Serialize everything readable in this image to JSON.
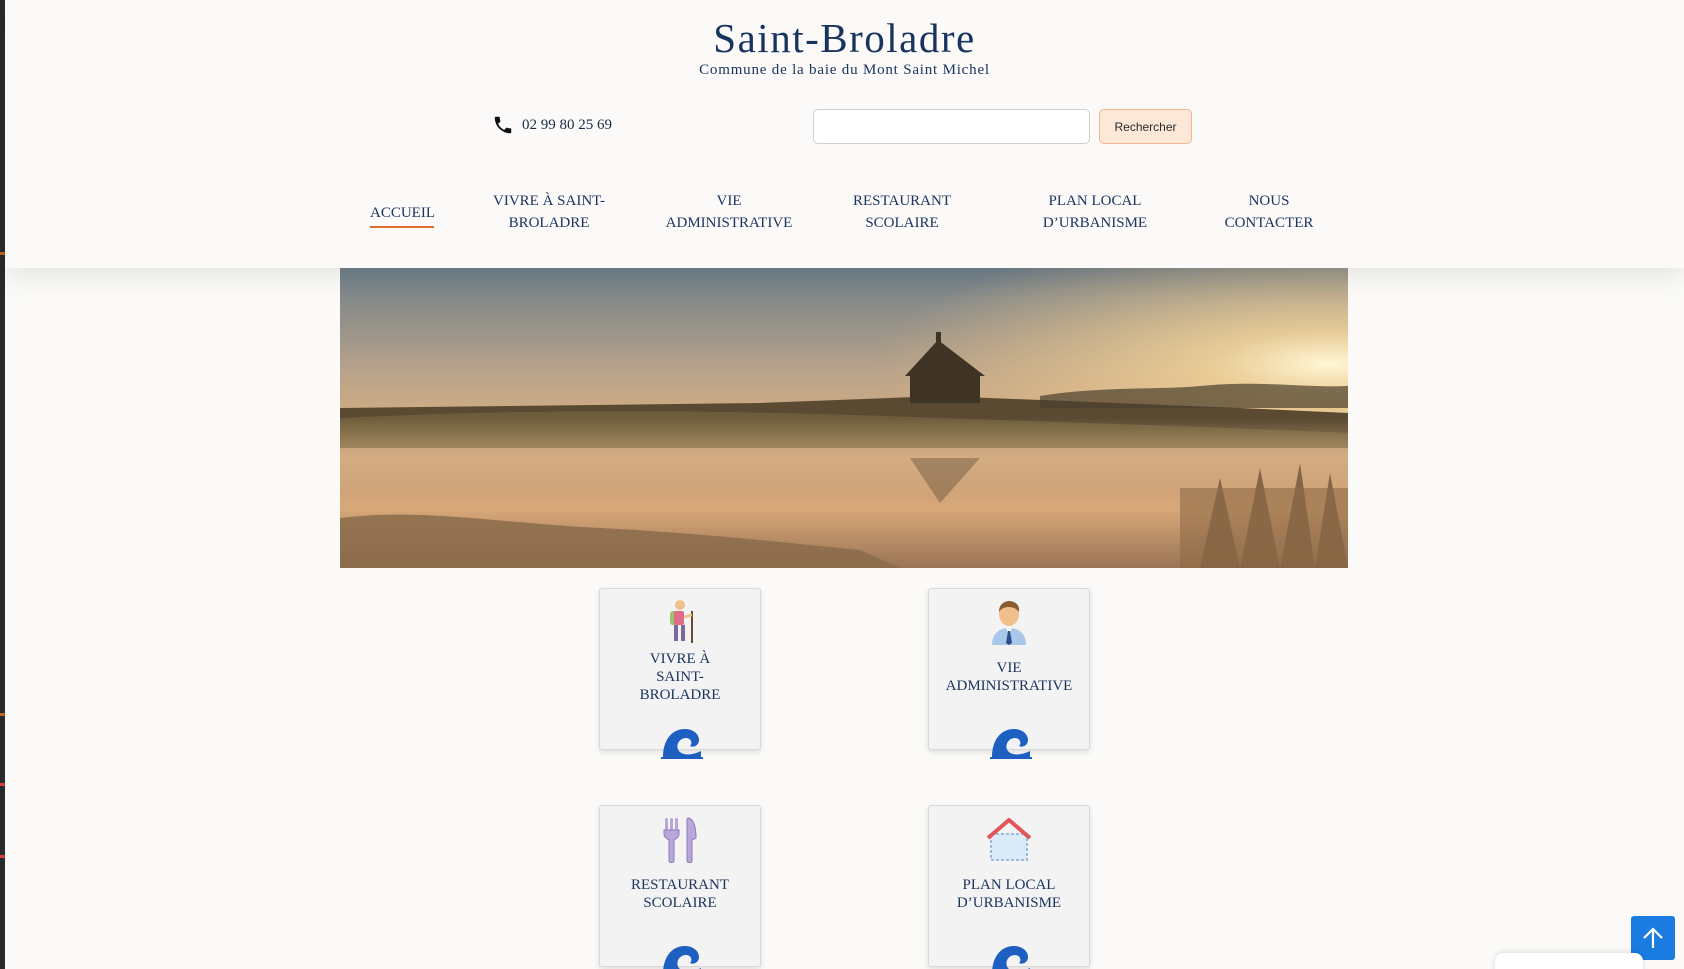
{
  "site": {
    "title": "Saint-Broladre",
    "tagline": "Commune de la baie du Mont Saint Michel"
  },
  "contact": {
    "phone": "02 99 80 25 69",
    "icon": "phone-icon"
  },
  "search": {
    "value": "",
    "button_label": "Rechercher"
  },
  "nav": {
    "items": [
      {
        "line1": "ACCUEIL",
        "line2": "",
        "active": true
      },
      {
        "line1": "VIVRE À SAINT-",
        "line2": "BROLADRE",
        "active": false
      },
      {
        "line1": "VIE",
        "line2": "ADMINISTRATIVE",
        "active": false
      },
      {
        "line1": "RESTAURANT",
        "line2": "SCOLAIRE",
        "active": false
      },
      {
        "line1": "PLAN LOCAL",
        "line2": "D’URBANISME",
        "active": false
      },
      {
        "line1": "NOUS",
        "line2": "CONTACTER",
        "active": false
      }
    ],
    "accent_color": "#e06b25"
  },
  "cards": [
    {
      "lines": [
        "VIVRE À",
        "SAINT-",
        "BROLADRE"
      ],
      "icon": "hiker-icon",
      "footer_icon": "wave-icon"
    },
    {
      "lines": [
        "VIE",
        "ADMINISTRATIVE"
      ],
      "icon": "administrator-person-icon",
      "footer_icon": "wave-icon"
    },
    {
      "lines": [
        "RESTAURANT",
        "SCOLAIRE"
      ],
      "icon": "fork-knife-icon",
      "footer_icon": "wave-icon"
    },
    {
      "lines": [
        "PLAN LOCAL",
        "D’URBANISME"
      ],
      "icon": "house-plan-icon",
      "footer_icon": "wave-icon"
    }
  ],
  "colors": {
    "title": "#17335e",
    "button_bg": "#fde7d7",
    "back_to_top": "#1a7ce0",
    "wave": "#1e5fc2"
  },
  "back_to_top": {
    "icon": "arrow-up-icon"
  }
}
